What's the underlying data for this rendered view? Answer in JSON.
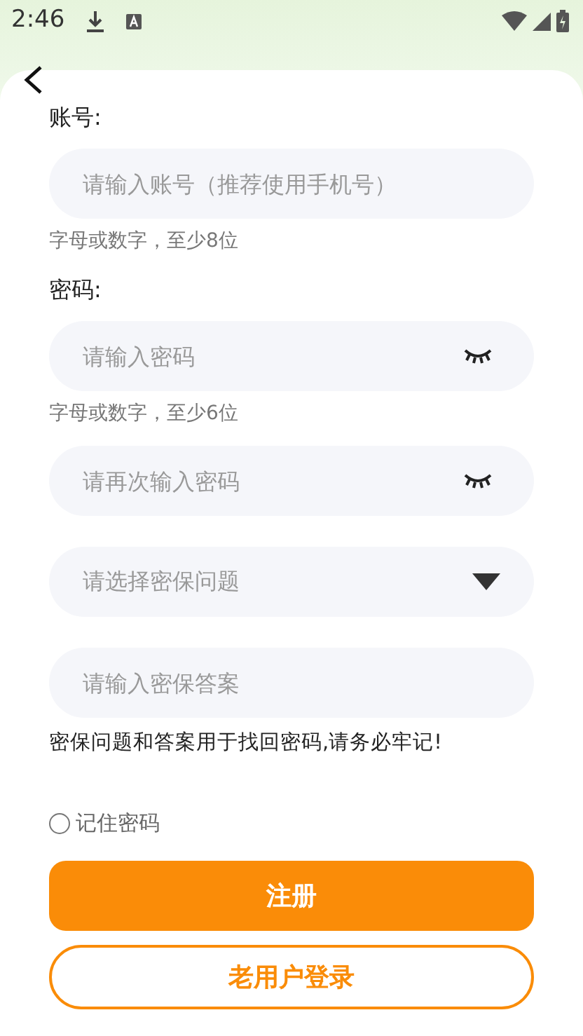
{
  "status_bar": {
    "time": "2:46"
  },
  "form": [
    {
      "kind": "label",
      "text": "账号:"
    },
    {
      "kind": "input",
      "placeholder": "请输入账号（推荐使用手机号）"
    },
    {
      "kind": "hint",
      "text": "字母或数字，至少8位"
    },
    {
      "kind": "label",
      "text": "密码:"
    },
    {
      "kind": "password",
      "placeholder": "请输入密码"
    },
    {
      "kind": "hint",
      "text": "字母或数字，至少6位"
    },
    {
      "kind": "password",
      "placeholder": "请再次输入密码"
    },
    {
      "kind": "select",
      "placeholder": "请选择密保问题"
    },
    {
      "kind": "input",
      "placeholder": "请输入密保答案"
    },
    {
      "kind": "note",
      "text": "密保问题和答案用于找回密码,请务必牢记!"
    }
  ],
  "remember": {
    "label": "记住密码",
    "checked": false
  },
  "buttons": [
    {
      "kind": "primary",
      "label": "注册"
    },
    {
      "kind": "outline",
      "label": "老用户登录"
    }
  ]
}
